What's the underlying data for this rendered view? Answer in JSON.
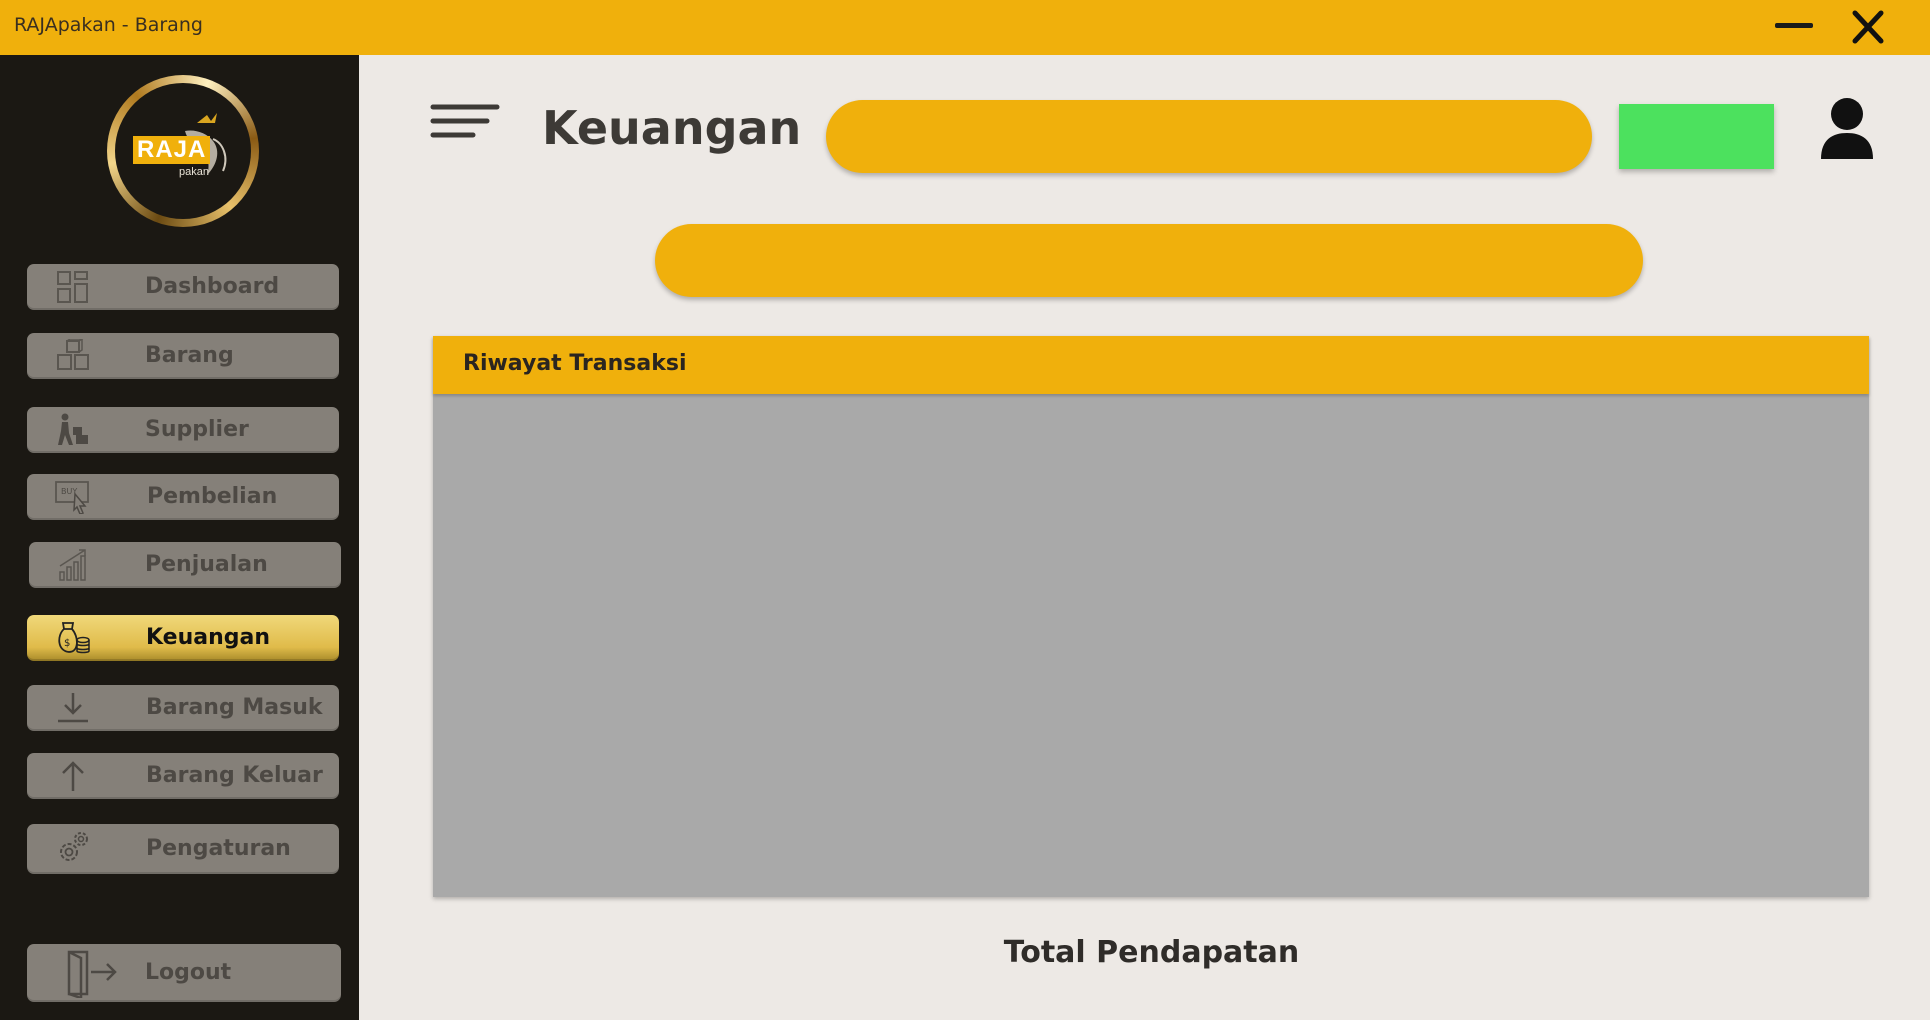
{
  "window": {
    "title": "RAJApakan - Barang"
  },
  "logo": {
    "brand": "RAJA",
    "sub": "pakan"
  },
  "sidebar": {
    "items": [
      {
        "label": "Dashboard",
        "icon": "dashboard-icon",
        "active": false
      },
      {
        "label": "Barang",
        "icon": "boxes-icon",
        "active": false
      },
      {
        "label": "Supplier",
        "icon": "supplier-icon",
        "active": false
      },
      {
        "label": "Pembelian",
        "icon": "buy-icon",
        "active": false
      },
      {
        "label": "Penjualan",
        "icon": "sales-chart-icon",
        "active": false
      },
      {
        "label": "Keuangan",
        "icon": "money-bag-icon",
        "active": true
      },
      {
        "label": "Barang Masuk",
        "icon": "download-icon",
        "active": false
      },
      {
        "label": "Barang Keluar",
        "icon": "arrow-up-icon",
        "active": false
      },
      {
        "label": "Pengaturan",
        "icon": "gear-icon",
        "active": false
      }
    ],
    "logout": {
      "label": "Logout",
      "icon": "logout-icon"
    }
  },
  "header": {
    "page_title": "Keuangan"
  },
  "table": {
    "title": "Riwayat Transaksi"
  },
  "summary": {
    "total_label": "Total Pendapatan"
  },
  "colors": {
    "accent": "#f0b00c",
    "sidebar_bg": "#1b1813",
    "content_bg": "#ede9e5",
    "button_green": "#4ce15e",
    "nav_button": "#858079",
    "table_body": "#a9a9a9"
  }
}
